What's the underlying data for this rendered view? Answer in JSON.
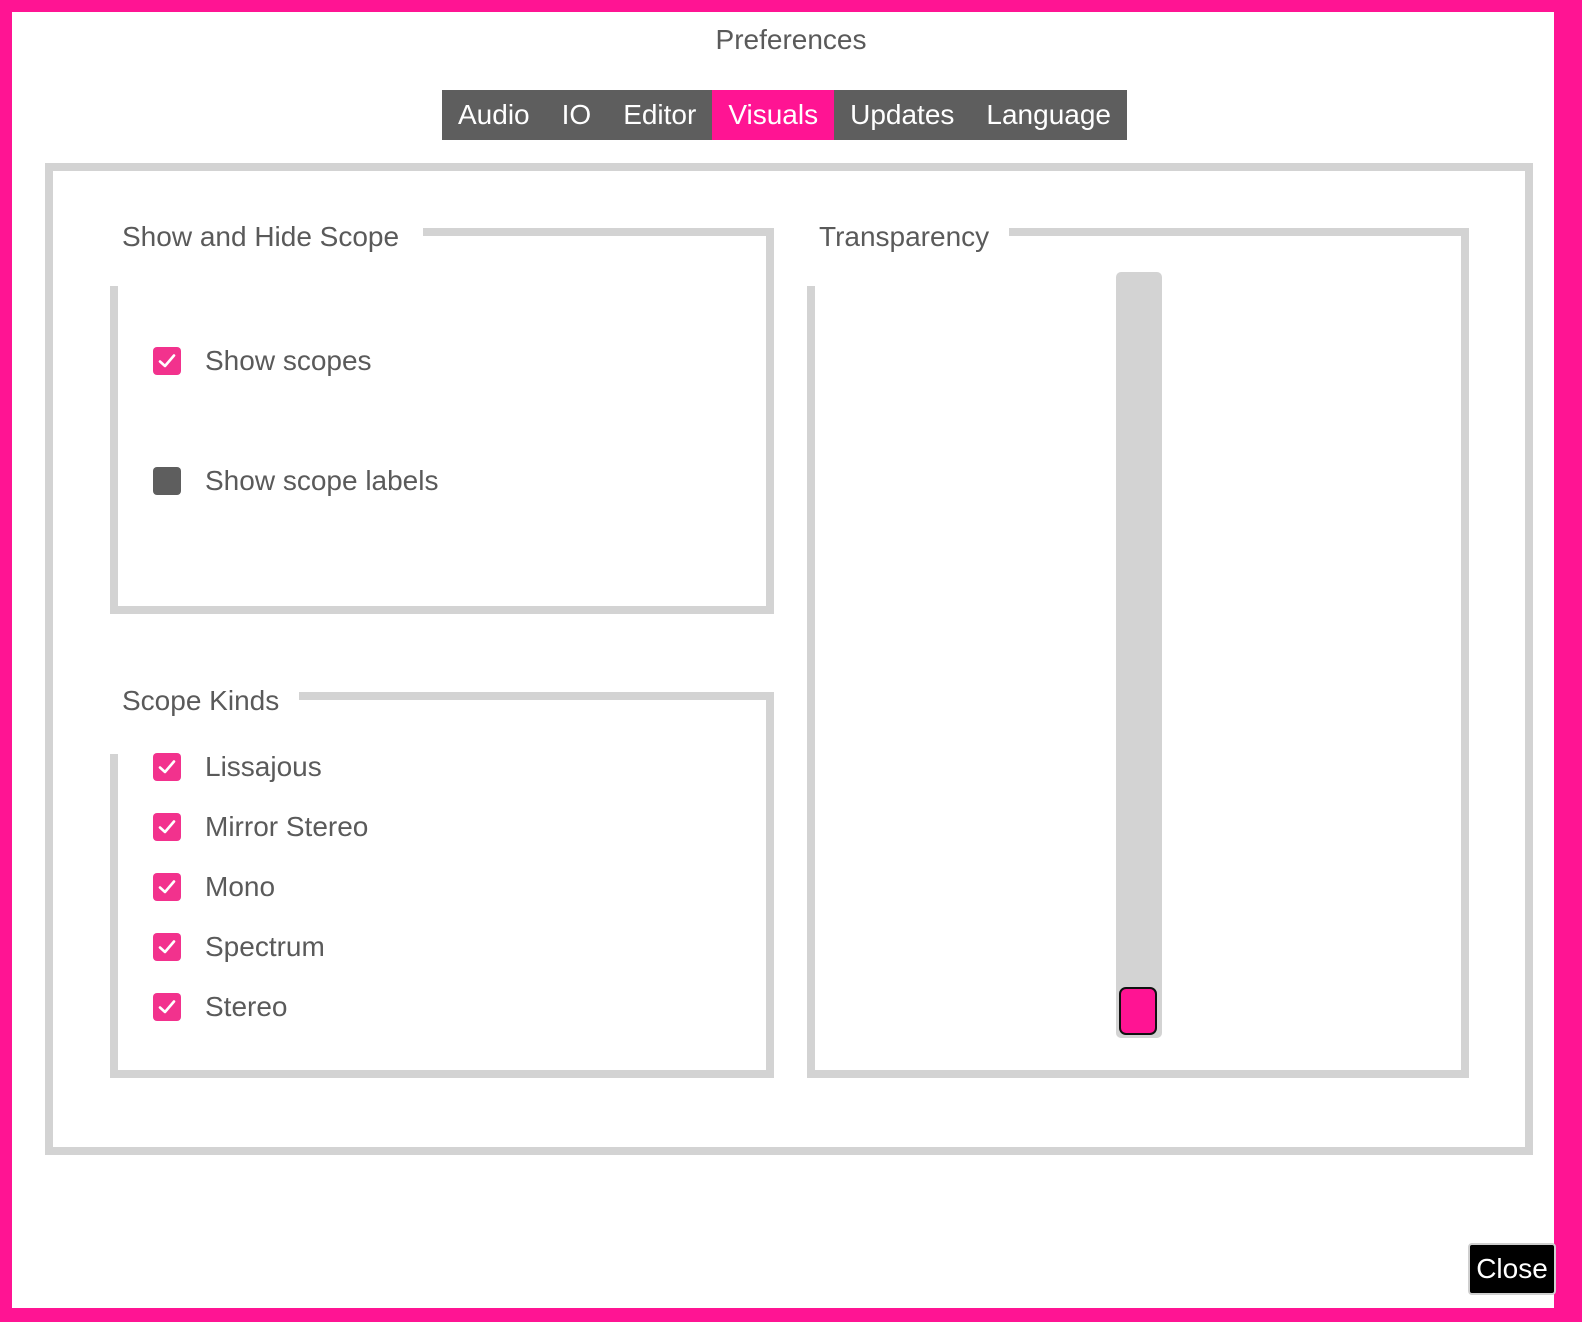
{
  "dialog": {
    "title": "Preferences"
  },
  "tabs": [
    {
      "label": "Audio",
      "active": false
    },
    {
      "label": "IO",
      "active": false
    },
    {
      "label": "Editor",
      "active": false
    },
    {
      "label": "Visuals",
      "active": true
    },
    {
      "label": "Updates",
      "active": false
    },
    {
      "label": "Language",
      "active": false
    }
  ],
  "show_hide_scope": {
    "legend": "Show and Hide Scope",
    "options": [
      {
        "label": "Show scopes",
        "checked": true
      },
      {
        "label": "Show scope labels",
        "checked": false
      }
    ]
  },
  "scope_kinds": {
    "legend": "Scope Kinds",
    "options": [
      {
        "label": "Lissajous",
        "checked": true
      },
      {
        "label": "Mirror Stereo",
        "checked": true
      },
      {
        "label": "Mono",
        "checked": true
      },
      {
        "label": "Spectrum",
        "checked": true
      },
      {
        "label": "Stereo",
        "checked": true
      }
    ]
  },
  "transparency": {
    "legend": "Transparency",
    "value_fraction": 0.0
  },
  "footer": {
    "close_label": "Close"
  },
  "colors": {
    "accent": "#ff1493",
    "tab_bar": "#5e5e5e",
    "border": "#d3d3d3",
    "text": "#5a5a5a"
  }
}
